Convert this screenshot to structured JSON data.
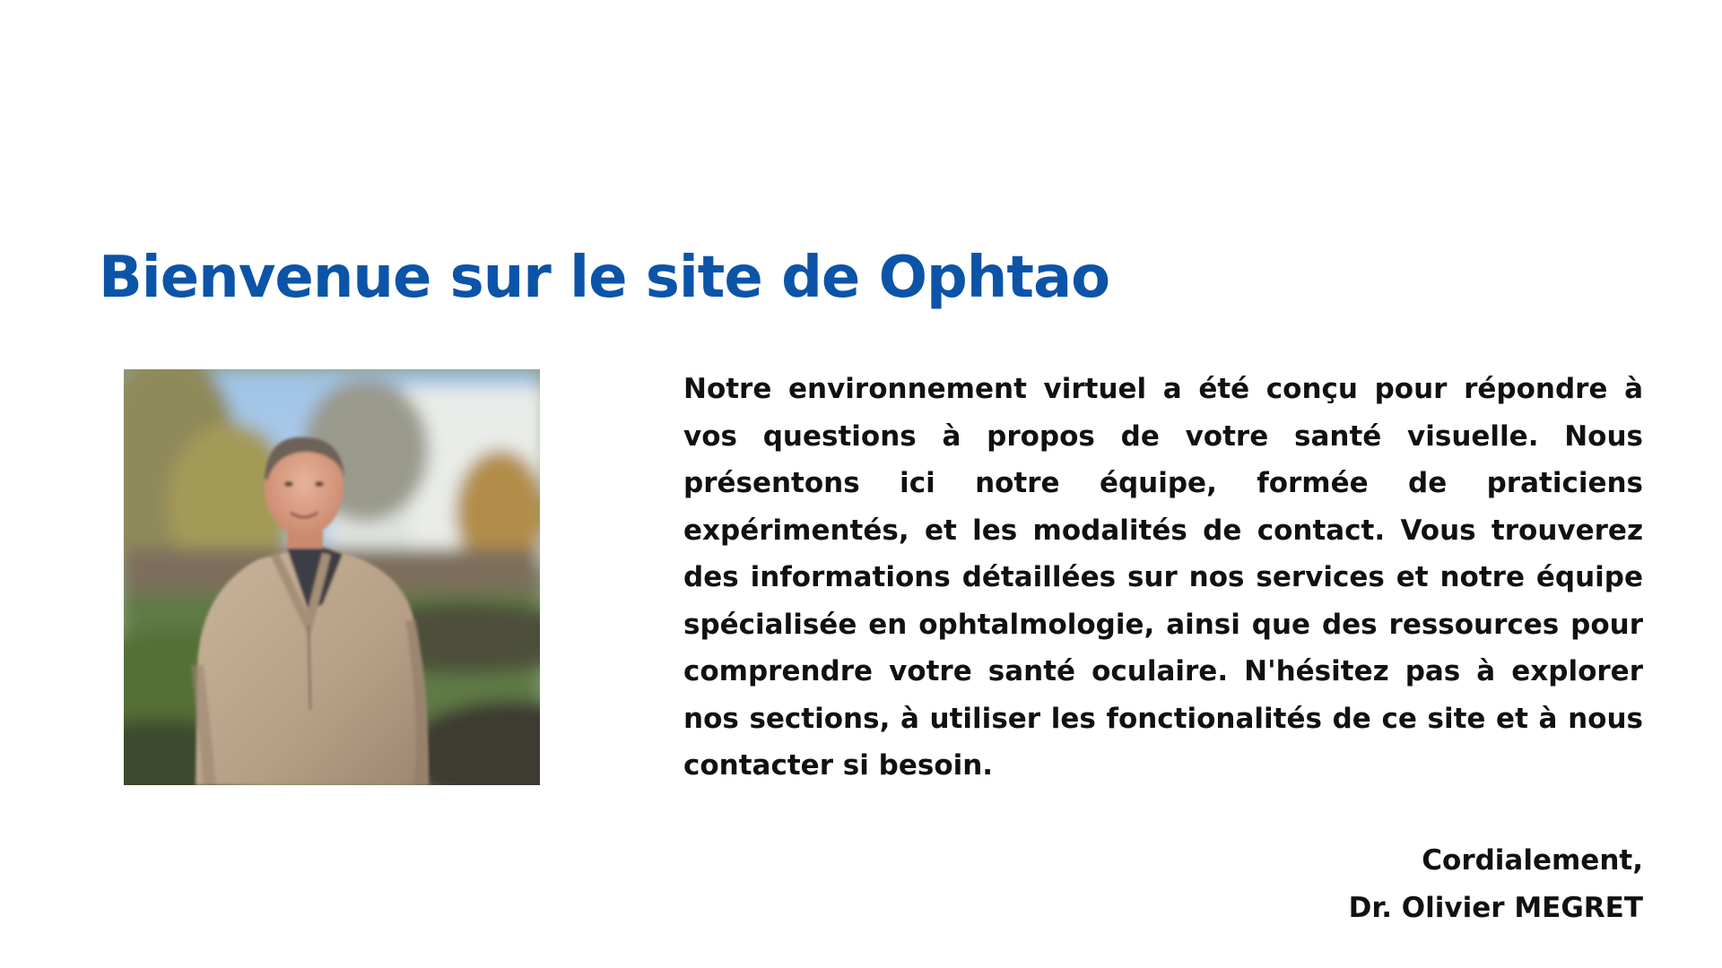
{
  "page": {
    "title": "Bienvenue sur le site de Ophtao",
    "title_color": "#0b54a8"
  },
  "portrait": {
    "icon": "doctor-portrait-photo"
  },
  "intro": {
    "text": "Notre environnement virtuel a été conçu pour répondre à vos questions à propos de votre santé visuelle. Nous présentons ici notre équipe, formée de praticiens expérimentés, et les modalités de contact. Vous trouverez des informations détaillées sur nos services et notre équipe spécialisée en ophtalmologie, ainsi que des ressources pour comprendre votre santé oculaire. N'hésitez pas à explorer nos sections, à utiliser les fonctionalités de ce site et à nous contacter si besoin."
  },
  "signoff": {
    "closing": "Cordialement,",
    "signature": "Dr. Olivier MEGRET"
  }
}
